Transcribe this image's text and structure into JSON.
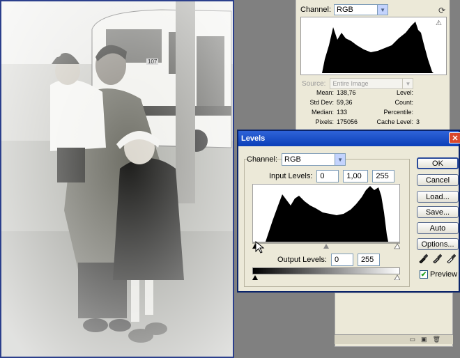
{
  "histogram_panel": {
    "channel_label": "Channel:",
    "channel_value": "RGB",
    "source_label": "Source:",
    "source_value": "Entire Image",
    "stats": [
      {
        "k": "Mean:",
        "v": "138,76",
        "k2": "Level:",
        "v2": ""
      },
      {
        "k": "Std Dev:",
        "v": "59,36",
        "k2": "Count:",
        "v2": ""
      },
      {
        "k": "Median:",
        "v": "133",
        "k2": "Percentile:",
        "v2": ""
      },
      {
        "k": "Pixels:",
        "v": "175056",
        "k2": "Cache Level:",
        "v2": "3"
      }
    ],
    "icons": [
      "refresh-icon",
      "warning-icon"
    ]
  },
  "photo": {
    "bus_number": "107"
  },
  "levels": {
    "title": "Levels",
    "channel_label": "Channel:",
    "channel_value": "RGB",
    "input_levels_label": "Input Levels:",
    "input_black": "0",
    "input_gamma": "1,00",
    "input_white": "255",
    "output_levels_label": "Output Levels:",
    "output_black": "0",
    "output_white": "255",
    "buttons": {
      "ok": "OK",
      "cancel": "Cancel",
      "load": "Load...",
      "save": "Save...",
      "auto": "Auto",
      "options": "Options..."
    },
    "preview_label": "Preview",
    "preview_checked": true,
    "close_glyph": "✕"
  },
  "colors": {
    "title_bar": "#0b3fb8",
    "dialog_bg": "#ece9d8",
    "workspace": "#808080"
  }
}
